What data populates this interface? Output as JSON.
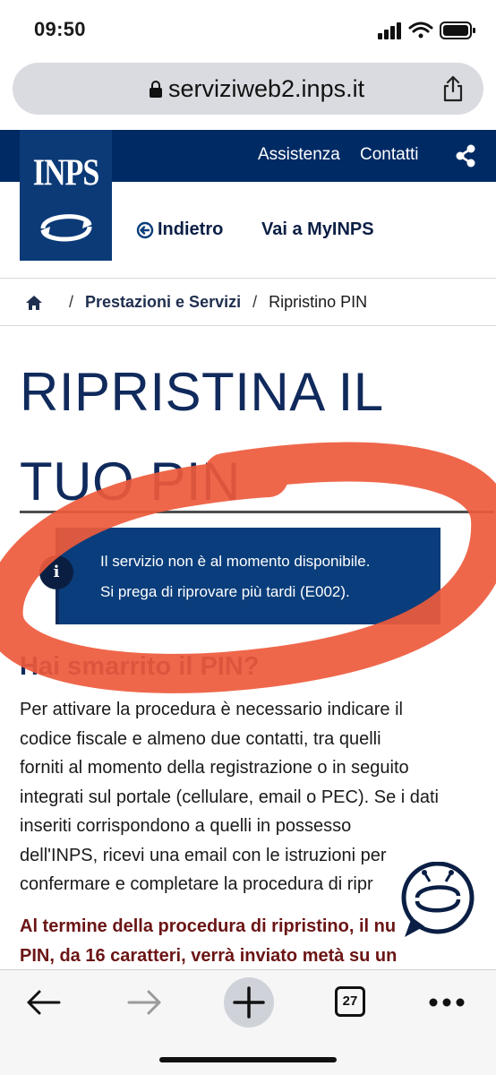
{
  "status_bar": {
    "time": "09:50"
  },
  "browser": {
    "url": "serviziweb2.inps.it",
    "tabs_count": "27"
  },
  "header": {
    "logo_text": "INPS",
    "top_links": [
      "Assistenza",
      "Contatti"
    ],
    "back_label": "Indietro",
    "myinps_label": "Vai a MyINPS",
    "brand_colors": {
      "primary": "#002a64",
      "logo": "#0b3a77"
    }
  },
  "breadcrumb": {
    "items": [
      "Prestazioni e Servizi",
      "Ripristino PIN"
    ]
  },
  "page": {
    "title_line1": "RIPRISTINA IL",
    "title_line2": "TUO PIN",
    "alert": {
      "icon": "info-icon",
      "line1": "Il servizio non è al momento disponibile.",
      "line2": "Si prega di riprovare più tardi (E002)."
    },
    "section_heading": "Hai smarrito il PIN?",
    "body_lines": [
      "Per attivare la procedura è necessario indicare il",
      "codice fiscale e almeno due contatti, tra quelli",
      "forniti al momento della registrazione o in seguito",
      "integrati sul portale (cellulare, email o PEC). Se i dati",
      "inseriti corrispondono a quelli in possesso",
      "dell'INPS, ricevi una email con le istruzioni per",
      "confermare e completare la procedura di ripr"
    ],
    "bold_lines": [
      "Al termine della procedura di ripristino, il nu",
      "PIN, da 16 caratteri, verrà inviato metà su un"
    ]
  },
  "annotation": {
    "color": "#ee5a3c"
  }
}
